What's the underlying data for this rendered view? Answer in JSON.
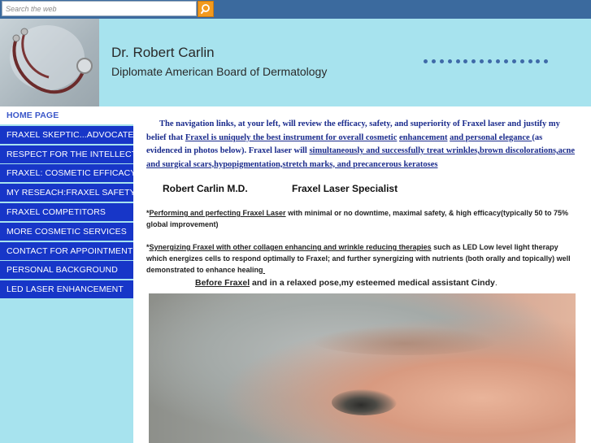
{
  "search": {
    "placeholder": "Search the web"
  },
  "header": {
    "title": "Dr. Robert Carlin",
    "subtitle": "Diplomate American Board of Dermatology",
    "dot_count": 16
  },
  "sidebar": {
    "items": [
      {
        "label": "HOME PAGE",
        "active": true
      },
      {
        "label": "FRAXEL SKEPTIC...ADVOCATE"
      },
      {
        "label": "RESPECT FOR THE INTELLECT"
      },
      {
        "label": "FRAXEL: COSMETIC EFFICACY"
      },
      {
        "label": "MY RESEACH:FRAXEL SAFETY"
      },
      {
        "label": "FRAXEL COMPETITORS"
      },
      {
        "label": "MORE COSMETIC SERVICES"
      },
      {
        "label": "CONTACT FOR APPOINTMENT"
      },
      {
        "label": "PERSONAL BACKGROUND"
      },
      {
        "label": "LED LASER ENHANCEMENT"
      }
    ]
  },
  "main": {
    "intro": {
      "t1": "The navigation links, at your left, will review the  efficacy, safety, and superiority of Fraxel laser and justify my belief that ",
      "l1": "Fraxel is uniquely the best  instrument for overall cosmetic",
      "t2": " ",
      "l2": "enhancement",
      "t3": " ",
      "l3": "and personal elegance ",
      "t4": "(as evidenced in photos below).  Fraxel laser will ",
      "l4": "simultaneously and successfully treat wrinkles,brown discolorations,acne",
      "t5": " ",
      "l5": "and surgical scars,hypopigmentation,stretch marks, and precancerous keratoses "
    },
    "signature_name": "Robert Carlin M.D.",
    "signature_role": "Fraxel Laser Specialist",
    "p2": {
      "star": "*",
      "u": "Performing and perfecting Fraxel Laser",
      "rest": "  with minimal or no downtime, maximal safety, & high efficacy(typically 50 to 75% global improvement)"
    },
    "p3": {
      "star": "*",
      "u": "Synergizing Fraxel with other collagen enhancing and wrinkle reducing therapies",
      "rest1": " such as LED Low level light therapy which energizes cells to respond optimally to Fraxel; and further synergizing with nutrients (both orally and topically) well demonstrated to enhance healing"
    },
    "caption": {
      "u": "Before Fraxel",
      "rest": " and in a relaxed pose,my esteemed medical assistant Cindy",
      "end": "."
    }
  },
  "colors": {
    "header_bg": "#a7e3ee",
    "nav_bg": "#1736c8",
    "topbar_bg": "#3b6a9e",
    "search_button": "#f39a1d"
  }
}
